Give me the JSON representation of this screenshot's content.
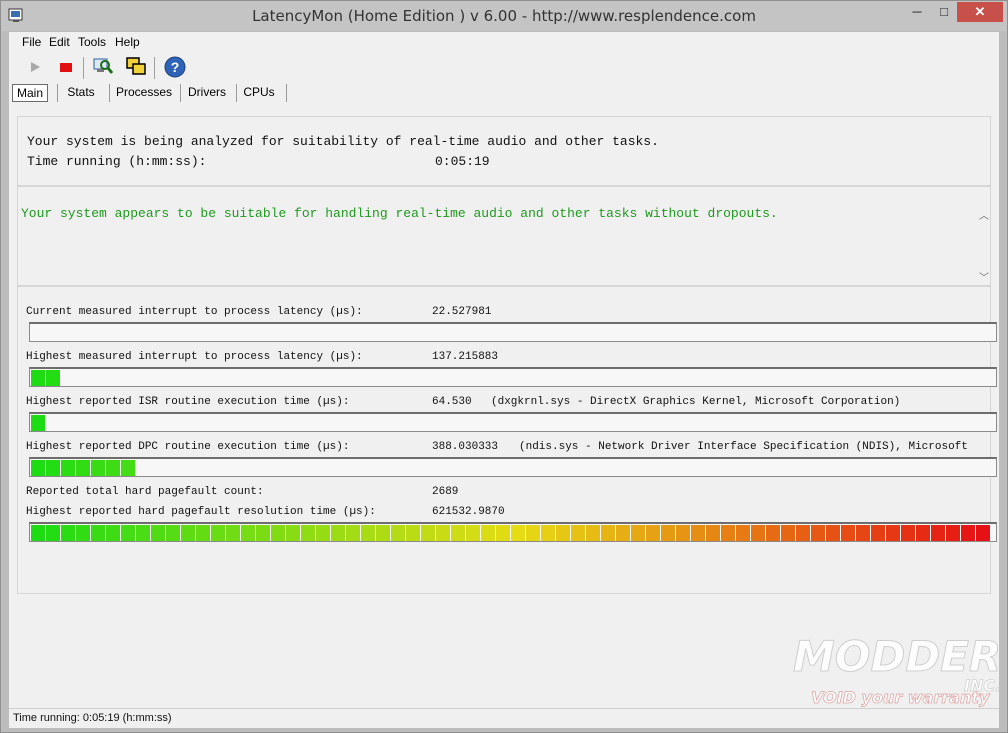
{
  "window": {
    "title": "LatencyMon  (Home Edition )  v 6.00 - http://www.resplendence.com",
    "min_glyph": "─",
    "max_glyph": "□",
    "close_glyph": "✕"
  },
  "menu": {
    "file": "File",
    "edit": "Edit",
    "tools": "Tools",
    "help": "Help"
  },
  "toolbar": {
    "icons": [
      "play-icon",
      "stop-icon",
      "search-computer-icon",
      "windows-icon",
      "help-icon"
    ],
    "help_glyph": "?"
  },
  "tabs": [
    "Main",
    "Stats",
    "Processes",
    "Drivers",
    "CPUs"
  ],
  "status_panel": {
    "line1": "Your system is being analyzed for suitability of real-time audio and other tasks.",
    "time_label": "Time running (h:mm:ss):",
    "time_value": "0:05:19"
  },
  "message": {
    "text": "Your system appears to be suitable for handling real-time audio and other tasks without dropouts.",
    "color": "#1e9a1e"
  },
  "metrics": {
    "current_latency_label": "Current measured interrupt to process latency (µs):",
    "current_latency_value": "22.527981",
    "highest_latency_label": "Highest measured interrupt to process latency (µs):",
    "highest_latency_value": "137.215883",
    "isr_label": "Highest reported ISR routine execution time (µs):",
    "isr_value": "64.530",
    "isr_detail": "(dxgkrnl.sys - DirectX Graphics Kernel, Microsoft Corporation)",
    "dpc_label": "Highest reported DPC routine execution time (µs):",
    "dpc_value": "388.030333",
    "dpc_detail": "(ndis.sys - Network Driver Interface Specification (NDIS), Microsoft",
    "pagefault_count_label": "Reported total hard pagefault count:",
    "pagefault_count_value": "2689",
    "pagefault_time_label": "Highest reported hard pagefault resolution time (µs):",
    "pagefault_time_value": "621532.9870"
  },
  "meters": {
    "current_latency_fraction": 0.0,
    "highest_latency_fraction": 0.032,
    "isr_fraction": 0.015,
    "dpc_fraction": 0.115,
    "pagefault_fraction": 1.0
  },
  "statusbar": {
    "text": "Time running: 0:05:19  (h:mm:ss)"
  },
  "watermark": {
    "line1": "MODDERS",
    "line2": "INC.",
    "line3": "VOID your warranty"
  }
}
